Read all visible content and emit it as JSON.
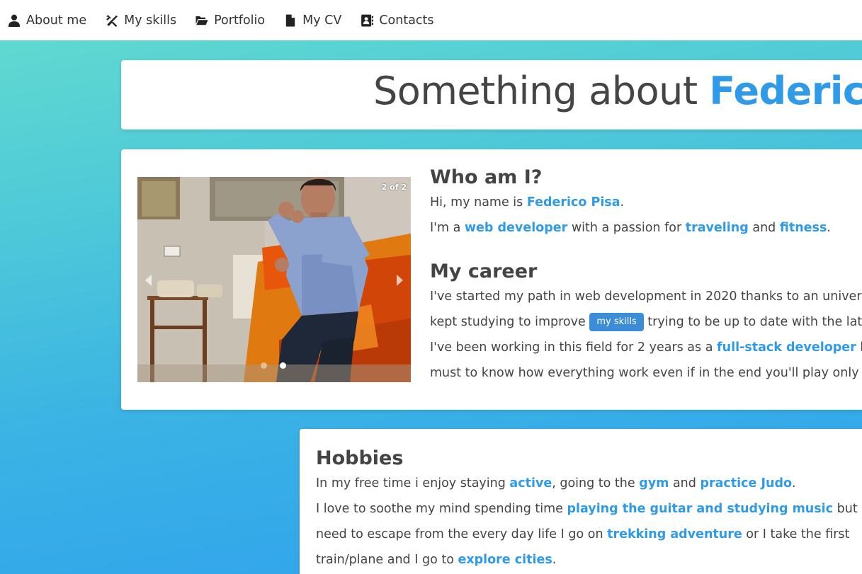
{
  "nav": {
    "items": [
      {
        "label": "About me",
        "icon": "user-icon"
      },
      {
        "label": "My skills",
        "icon": "tools-icon"
      },
      {
        "label": "Portfolio",
        "icon": "folder-open-icon"
      },
      {
        "label": "My CV",
        "icon": "file-icon"
      },
      {
        "label": "Contacts",
        "icon": "address-book-icon"
      }
    ]
  },
  "title": {
    "prefix": "Something about ",
    "name": "Federico"
  },
  "carousel": {
    "counter": "2 of 2",
    "slide_count": 2,
    "active_slide": 2
  },
  "about": {
    "heading": "Who am I?",
    "line1": {
      "pre": "Hi, my name is ",
      "link": "Federico Pisa",
      "post": "."
    },
    "line2": {
      "pre": "I'm a ",
      "link1": "web developer",
      "mid1": " with a passion for ",
      "link2": "traveling",
      "mid2": " and ",
      "link3": "fitness",
      "post": "."
    }
  },
  "career": {
    "heading": "My career",
    "line1": "I've started my path in web development in 2020 thanks to an univeristy's",
    "line2": {
      "pre": "kept studying to improve ",
      "pill": "my skills",
      "post": " trying to be up to date with the latest a"
    },
    "line3": {
      "pre": "I've been working in this field for 2 years as a ",
      "link": "full-stack developer",
      "post": " becau"
    },
    "line4": "must to know how everything work even if in the end you'll play only one"
  },
  "hobbies": {
    "heading": "Hobbies",
    "line1": {
      "pre": "In my free time i enjoy staying ",
      "link1": "active",
      "mid1": ", going to the ",
      "link2": "gym",
      "mid2": " and ",
      "link3": "practice Judo",
      "post": "."
    },
    "line2": {
      "pre": "I love to soothe my mind spending time ",
      "link": "playing the guitar and studying music",
      "post": " but when i"
    },
    "line3": {
      "pre": "need to escape from the every day life I go on ",
      "link": "trekking adventure",
      "post": " or I take the first"
    },
    "line4": {
      "pre": "train/plane and I go to ",
      "link": "explore cities",
      "post": "."
    }
  },
  "colors": {
    "accent": "#2f9ae8",
    "pill": "#3a8dd6",
    "gradient_top": "#64dccf",
    "gradient_bottom": "#2ea0ee"
  }
}
